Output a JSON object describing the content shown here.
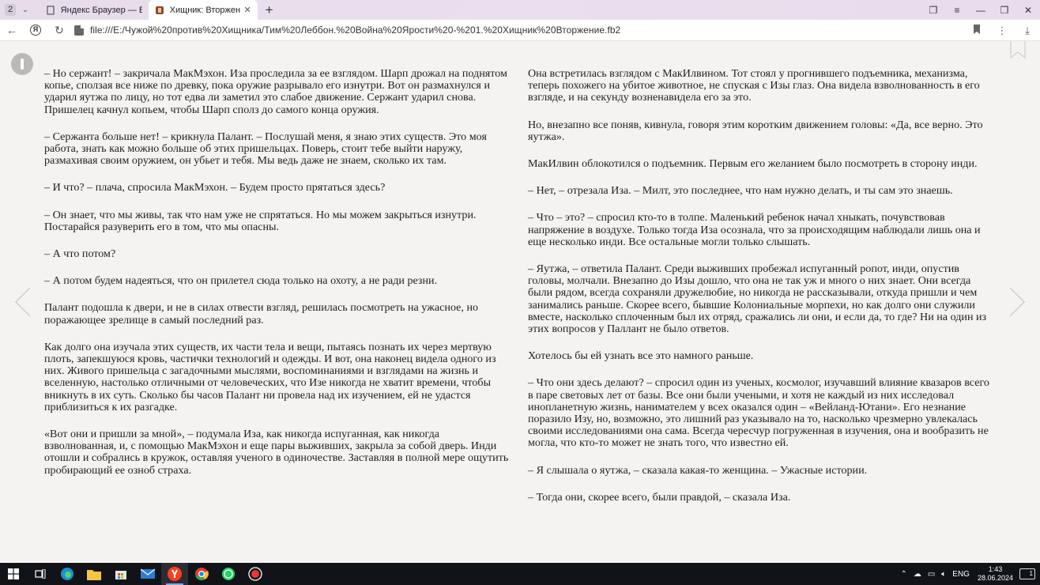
{
  "tabs": {
    "count": "2",
    "items": [
      {
        "title": "Яндекс Браузер — Выра",
        "active": false
      },
      {
        "title": "Хищник: Вторжение - Т",
        "active": true
      }
    ]
  },
  "address": {
    "url": "file:///E:/Чужой%20против%20Хищника/Тим%20Леббон.%20Война%20Ярости%20-%201.%20Хищник%20Вторжение.fb2"
  },
  "content": {
    "left": [
      "– Но сержант! – закричала МакМэхон. Иза проследила за ее взглядом. Шарп дрожал на поднятом копье, сползая все ниже по древку, пока оружие разрывало его изнутри. Вот он размахнулся и ударил яутжа по лицу, но тот едва ли заметил это слабое движение. Сержант ударил снова. Пришелец качнул копьем, чтобы Шарп сполз до самого конца оружия.",
      "– Сержанта больше нет! – крикнула Палант. – Послушай меня, я знаю этих существ. Это моя работа, знать как можно больше об этих пришельцах. Поверь, стоит тебе выйти наружу, размахивая своим оружием, он убьет и тебя. Мы ведь даже не знаем, сколько их там.",
      "– И что? – плача, спросила МакМэхон. – Будем просто прятаться здесь?",
      "– Он знает, что мы живы, так что нам уже не спрятаться. Но мы можем закрыться изнутри. Постарайся разуверить его в том, что мы опасны.",
      "– А что потом?",
      "– А потом будем надеяться, что он прилетел сюда только на охоту, а не ради резни.",
      "Палант подошла к двери, и не в силах отвести взгляд, решилась посмотреть на ужасное, но поражающее зрелище в самый последний раз.",
      "Как долго она изучала этих существ, их части тела и вещи, пытаясь познать их через мертвую плоть, запекшуюся кровь, частички технологий и одежды. И вот, она наконец видела одного из них. Живого пришельца с загадочными мыслями, воспоминаниями и взглядами на жизнь и вселенную, настолько отличными от человеческих, что Изе никогда не хватит времени, чтобы вникнуть в их суть. Сколько бы часов Палант ни провела над их изучением, ей не удастся приблизиться к их разгадке.",
      "«Вот они и пришли за мной», – подумала Иза, как никогда испуганная, как никогда взволнованная, и, с помощью МакМэхон и еще пары выживших, закрыла за собой дверь. Инди отошли и собрались в кружок, оставляя ученого в одиночестве. Заставляя в полной мере ощутить пробирающий ее озноб страха."
    ],
    "right": [
      "Она встретилась взглядом с МакИлвином. Тот стоял у прогнившего подъемника, механизма, теперь похожего на убитое животное, не спуская с Изы глаз. Она видела взволнованность в его взгляде, и на секунду возненавидела его за это.",
      "Но, внезапно все поняв, кивнула, говоря этим коротким движением головы: «Да, все верно. Это яутжа».",
      "МакИлвин облокотился о подъемник. Первым его желанием было посмотреть в сторону инди.",
      "– Нет, – отрезала Иза. – Милт, это последнее, что нам нужно делать, и ты сам это знаешь.",
      "– Что – это? – спросил кто-то в толпе. Маленький ребенок начал хныкать, почувствовав напряжение в воздухе. Только тогда Иза осознала, что за происходящим наблюдали лишь она и еще несколько инди. Все остальные могли только слышать.",
      "– Яутжа, – ответила Палант. Среди выживших пробежал испуганный ропот, инди, опустив головы, молчали. Внезапно до Изы дошло, что она не так уж и много о них знает. Они всегда были рядом, всегда сохраняли дружелюбие, но никогда не рассказывали, откуда пришли и чем занимались раньше. Скорее всего, бывшие Колониальные морпехи, но как долго они служили вместе, насколько сплоченным был их отряд, сражались ли они, и если да, то где? Ни на один из этих вопросов у Паллант не было ответов.",
      "Хотелось бы ей узнать все это намного раньше.",
      "– Что они здесь делают? – спросил один из ученых, космолог, изучавший влияние квазаров всего в паре световых лет от базы. Все они были учеными, и хотя не каждый из них исследовал инопланетную жизнь, нанимателем у всех оказался один – «Вейланд-Ютани». Его незнание поразило Изу, но, возможно, это лишний раз указывало на то, насколько чрезмерно увлекалась своими исследованиями она сама. Всегда чересчур погруженная в изучения, она и вообразить не могла, что кто-то может не знать того, что известно ей.",
      "– Я слышала о яутжа, – сказала какая-то женщина. – Ужасные истории.",
      "– Тогда они, скорее всего, были правдой, – сказала Иза."
    ]
  },
  "taskbar": {
    "lang": "ENG",
    "time": "1:43",
    "date": "28.06.2024",
    "notifications": "1"
  },
  "colors": {
    "tabbar": "#e8ddec",
    "page_bg": "#f4f3f1",
    "taskbar": "#111318"
  }
}
